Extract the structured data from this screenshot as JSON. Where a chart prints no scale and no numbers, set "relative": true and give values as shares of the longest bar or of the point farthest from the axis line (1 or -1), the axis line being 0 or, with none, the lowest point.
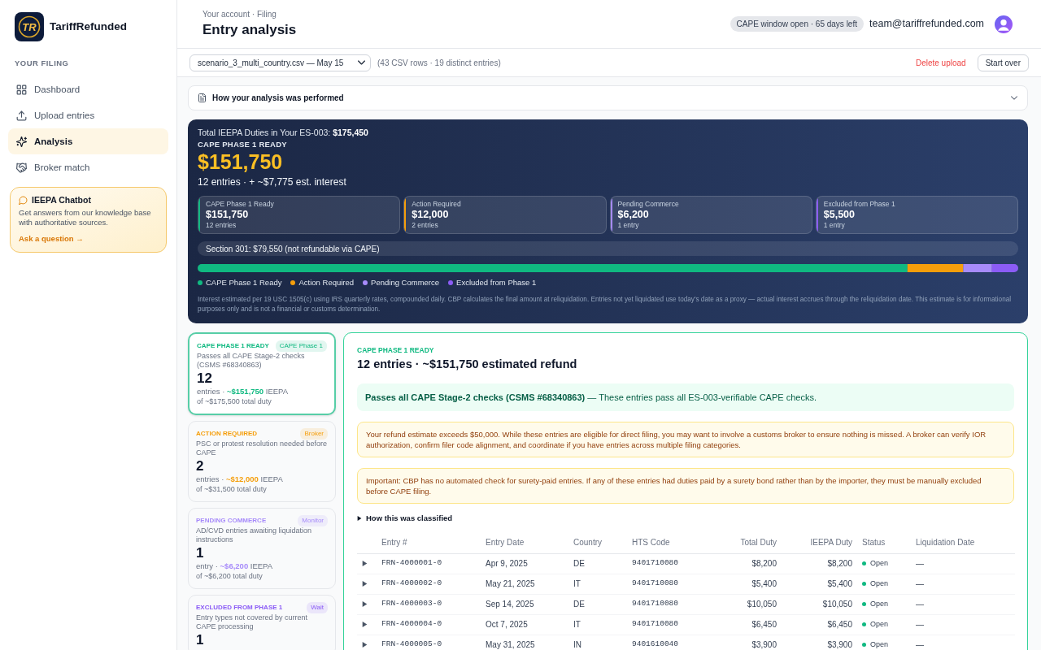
{
  "sidebar": {
    "logo": "TR",
    "brand": "TariffRefunded",
    "section_label": "YOUR FILING",
    "nav": [
      {
        "label": "Dashboard",
        "selected": false
      },
      {
        "label": "Upload entries",
        "selected": false
      },
      {
        "label": "Analysis",
        "selected": true
      },
      {
        "label": "Broker match",
        "selected": false
      }
    ],
    "chatbot": {
      "title": "IEEPA Chatbot",
      "text": "Get answers from our knowledge base with authoritative sources.",
      "link": "Ask a question →"
    }
  },
  "header": {
    "breadcrumb": "Your account · Filing",
    "title": "Entry analysis",
    "window_badge": "CAPE window open · 65 days left",
    "email": "team@tariffrefunded.com"
  },
  "toolbar": {
    "file_select": "scenario_3_multi_country.csv — May 15",
    "file_info": "(43 CSV rows · 19 distinct entries)",
    "delete_button": "Delete upload",
    "start_over_button": "Start over"
  },
  "method_panel": {
    "title": "How your analysis was performed",
    "expanded": false
  },
  "summary": {
    "total_line": "Total IEEPA Duties in Your ES-003: **$175,450**",
    "eyebrow": "CAPE PHASE 1 READY",
    "amount": "$151,750",
    "subline": "12 entries · + ~$7,775 est. interest",
    "stats": [
      {
        "label": "CAPE Phase 1 Ready",
        "value": "$151,750",
        "count": "12 entries",
        "color": "#10b981"
      },
      {
        "label": "Action Required",
        "value": "$12,000",
        "count": "2 entries",
        "color": "#f59e0b"
      },
      {
        "label": "Pending Commerce",
        "value": "$6,200",
        "count": "1 entry",
        "color": "#a78bfa"
      },
      {
        "label": "Excluded from Phase 1",
        "value": "$5,500",
        "count": "1 entry",
        "color": "#8b5cf6"
      }
    ],
    "section_301": "Section 301: $79,550 (not refundable via CAPE)",
    "chart_data": {
      "type": "bar",
      "orientation": "horizontal",
      "stacked": true,
      "relative": true,
      "series": [
        {
          "name": "CAPE Phase 1 Ready",
          "color": "#10b981",
          "values": [
            0.865
          ]
        },
        {
          "name": "Action Required",
          "color": "#f59e0b",
          "values": [
            0.068
          ]
        },
        {
          "name": "Pending Commerce",
          "color": "#a78bfa",
          "values": [
            0.035
          ]
        },
        {
          "name": "Excluded from Phase 1",
          "color": "#8b5cf6",
          "values": [
            0.032
          ]
        }
      ]
    },
    "disclaimer": "Interest estimated per 19 USC 1505(c) using IRS quarterly rates, compounded daily. CBP calculates the final amount at reliquidation. Entries not yet liquidated use today's date as a proxy — actual interest accrues through the reliquidation date. This estimate is for informational purposes only and is not a financial or customs determination."
  },
  "categories": [
    {
      "title": "CAPE PHASE 1 READY",
      "badge": "CAPE Phase 1",
      "description": "Passes all CAPE Stage-2 checks (CSMS #68340863)",
      "count": "12",
      "summary": "entries · **~$151,750** IEEPA",
      "total": "of ~$175,500 total duty",
      "color": "#10b981",
      "selected": true
    },
    {
      "title": "ACTION REQUIRED",
      "badge": "Broker",
      "description": "PSC or protest resolution needed before CAPE",
      "count": "2",
      "summary": "entries · **~$12,000** IEEPA",
      "total": "of ~$31,500 total duty",
      "color": "#f59e0b",
      "selected": false
    },
    {
      "title": "PENDING COMMERCE",
      "badge": "Monitor",
      "description": "AD/CVD entries awaiting liquidation instructions",
      "count": "1",
      "summary": "entry · **~$6,200** IEEPA",
      "total": "of ~$6,200 total duty",
      "color": "#a78bfa",
      "selected": false
    },
    {
      "title": "EXCLUDED FROM PHASE 1",
      "badge": "Wait",
      "description": "Entry types not covered by current CAPE processing",
      "count": "1",
      "color": "#8b5cf6",
      "selected": false
    }
  ],
  "detail": {
    "eyebrow": "CAPE PHASE 1 READY",
    "heading": "12 entries · ~$151,750 estimated refund",
    "notices": [
      {
        "kind": "success",
        "text": "**Passes all CAPE Stage-2 checks (CSMS #68340863)** — These entries pass all ES-003-verifiable CAPE checks."
      },
      {
        "kind": "warning",
        "text": "Your refund estimate exceeds $50,000. While these entries are eligible for direct filing, you may want to involve a customs broker to ensure nothing is missed. A broker can verify IOR authorization, confirm filer code alignment, and coordinate if you have entries across multiple filing categories."
      },
      {
        "kind": "warning",
        "text": "Important: CBP has no automated check for surety-paid entries. If any of these entries had duties paid by a surety bond rather than by the importer, they must be manually excluded before CAPE filing."
      }
    ],
    "classification": {
      "label": "How this was classified",
      "expanded": false
    },
    "table": {
      "columns": [
        "Entry #",
        "Entry Date",
        "Country",
        "HTS Code",
        "Total Duty",
        "IEEPA Duty",
        "Status",
        "Liquidation Date"
      ],
      "rows": [
        {
          "entry": "FRN-4000001-0",
          "entry_date": "Apr 9, 2025",
          "country": "DE",
          "hts_code": "9401710080",
          "total_duty": "$8,200",
          "ieepa_duty": "$8,200",
          "status": {
            "label": "Open",
            "color": "#10b981"
          },
          "liquidation_date": "—"
        },
        {
          "entry": "FRN-4000002-0",
          "entry_date": "May 21, 2025",
          "country": "IT",
          "hts_code": "9401710080",
          "total_duty": "$5,400",
          "ieepa_duty": "$5,400",
          "status": {
            "label": "Open",
            "color": "#10b981"
          },
          "liquidation_date": "—"
        },
        {
          "entry": "FRN-4000003-0",
          "entry_date": "Sep 14, 2025",
          "country": "DE",
          "hts_code": "9401710080",
          "total_duty": "$10,050",
          "ieepa_duty": "$10,050",
          "status": {
            "label": "Open",
            "color": "#10b981"
          },
          "liquidation_date": "—"
        },
        {
          "entry": "FRN-4000004-0",
          "entry_date": "Oct 7, 2025",
          "country": "IT",
          "hts_code": "9401710080",
          "total_duty": "$6,450",
          "ieepa_duty": "$6,450",
          "status": {
            "label": "Open",
            "color": "#10b981"
          },
          "liquidation_date": "—"
        },
        {
          "entry": "FRN-4000005-0",
          "entry_date": "May 31, 2025",
          "country": "IN",
          "hts_code": "9401610040",
          "total_duty": "$3,900",
          "ieepa_duty": "$3,900",
          "status": {
            "label": "Open",
            "color": "#10b981"
          },
          "liquidation_date": "—"
        }
      ]
    }
  }
}
